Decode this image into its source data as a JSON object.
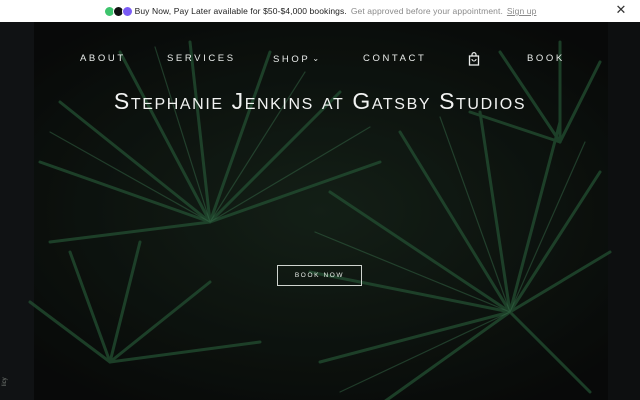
{
  "promo": {
    "main_text": "Buy Now, Pay Later available for $50-$4,000 bookings.",
    "sub_text": "Get approved before your appointment.",
    "link_label": "Sign up",
    "close_glyph": "✕",
    "logo_colors": [
      "#3ec46d",
      "#111111",
      "#7b5cf5"
    ]
  },
  "nav": {
    "about": "ABOUT",
    "services": "SERVICES",
    "shop": "SHOP",
    "shop_chevron": "⌄",
    "contact": "CONTACT",
    "book": "BOOK",
    "cart_icon": "shopping-bag-icon"
  },
  "hero": {
    "title": "Stephanie Jenkins at Gatsby Studios",
    "cta_label": "BOOK NOW",
    "side_text": "licy"
  },
  "colors": {
    "background": "#121416",
    "foliage": "#1f4a2f",
    "text": "#f2f3f2"
  }
}
